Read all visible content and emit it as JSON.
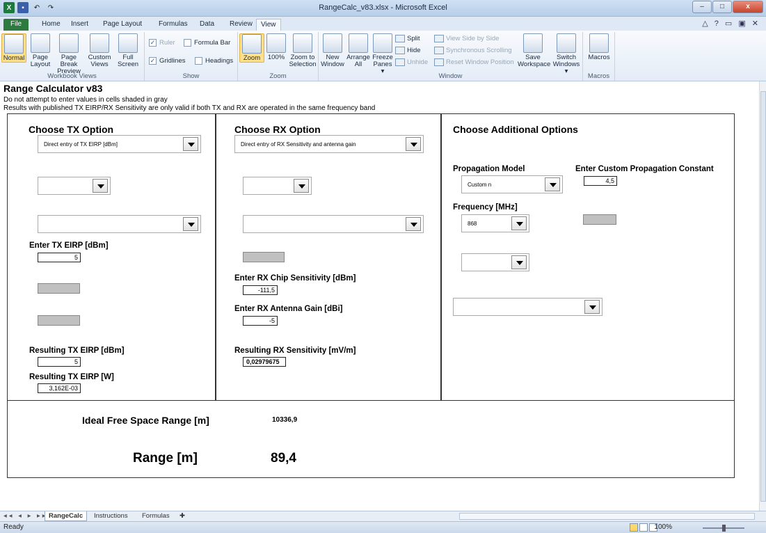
{
  "window": {
    "title": "RangeCalc_v83.xlsx - Microsoft Excel",
    "minimize": "–",
    "maximize": "□",
    "close": "x"
  },
  "tabs": [
    "File",
    "Home",
    "Insert",
    "Page Layout",
    "Formulas",
    "Data",
    "Review",
    "View"
  ],
  "active_tab": "View",
  "ribbon": {
    "workbook_views": {
      "label": "Workbook Views",
      "normal": "Normal",
      "page_layout": "Page Layout",
      "page_break": "Page Break Preview",
      "custom_views": "Custom Views",
      "full_screen": "Full Screen"
    },
    "show": {
      "label": "Show",
      "ruler": "Ruler",
      "gridlines": "Gridlines",
      "formula_bar": "Formula Bar",
      "headings": "Headings"
    },
    "zoom": {
      "label": "Zoom",
      "zoom": "Zoom",
      "hundred": "100%",
      "zoom_to_selection": "Zoom to Selection"
    },
    "window": {
      "label": "Window",
      "new_window": "New Window",
      "arrange_all": "Arrange All",
      "freeze_panes": "Freeze Panes ▾",
      "split": "Split",
      "hide": "Hide",
      "unhide": "Unhide",
      "view_side_by_side": "View Side by Side",
      "sync_scrolling": "Synchronous Scrolling",
      "reset_window_position": "Reset Window Position",
      "save_workspace": "Save Workspace",
      "switch_windows": "Switch Windows ▾"
    },
    "macros": {
      "label": "Macros",
      "macros": "Macros"
    }
  },
  "sheet": {
    "title": "Range Calculator v83",
    "note1": "Do not attempt to enter values in cells shaded in gray",
    "note2": "Results with published TX EIRP/RX Sensitivity are only valid if both TX and RX are operated in the same frequency band",
    "tx": {
      "heading": "Choose TX Option",
      "option": "Direct entry of TX EIRP [dBm]",
      "eirp_label": "Enter TX EIRP [dBm]",
      "eirp_value": "5",
      "result_dbm_label": "Resulting TX EIRP [dBm]",
      "result_dbm_value": "5",
      "result_w_label": "Resulting TX EIRP [W]",
      "result_w_value": "3,162E-03"
    },
    "rx": {
      "heading": "Choose RX Option",
      "option": "Direct entry of RX Sensitivity and antenna gain",
      "chip_label": "Enter RX Chip Sensitivity [dBm]",
      "chip_value": "-111,5",
      "gain_label": "Enter RX Antenna Gain [dBi]",
      "gain_value": "-5",
      "result_label": "Resulting RX Sensitivity [mV/m]",
      "result_value": "0,02979675"
    },
    "additional": {
      "heading": "Choose Additional Options",
      "prop_label": "Propagation Model",
      "prop_value": "Custom n",
      "const_label": "Enter Custom Propagation Constant",
      "const_value": "4,5",
      "freq_label": "Frequency [MHz]",
      "freq_value": "868"
    },
    "results": {
      "ideal_label": "Ideal Free Space Range [m]",
      "ideal_value": "10336,9",
      "range_label": "Range [m]",
      "range_value": "89,4"
    }
  },
  "sheet_tabs": [
    "RangeCalc",
    "Instructions",
    "Formulas"
  ],
  "status": {
    "ready": "Ready",
    "zoom": "100%"
  }
}
